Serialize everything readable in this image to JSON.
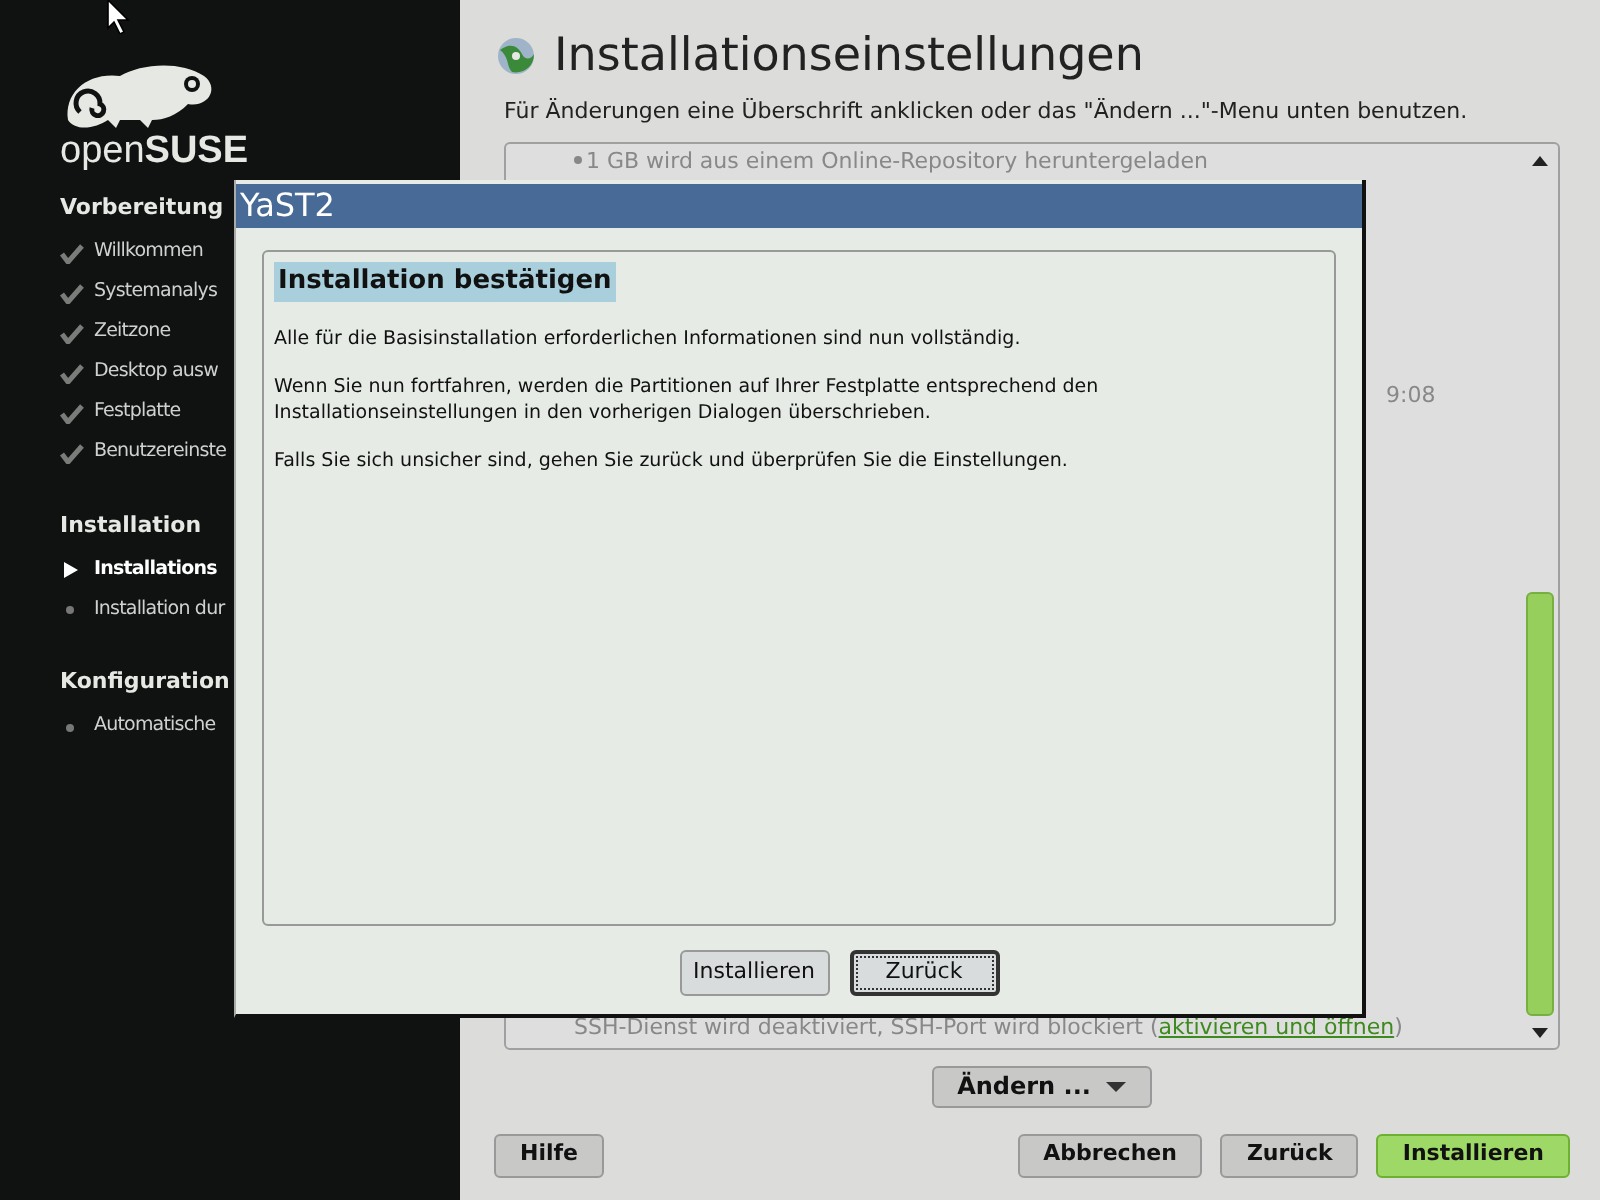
{
  "sidebar": {
    "logo_text": "open**SUSE**",
    "sections": [
      {
        "title": "Vorbereitung",
        "items": [
          {
            "label": "Willkommen",
            "done": true,
            "current": false
          },
          {
            "label": "Systemanalys",
            "done": true,
            "current": false
          },
          {
            "label": "Zeitzone",
            "done": true,
            "current": false
          },
          {
            "label": "Desktop ausw",
            "done": true,
            "current": false
          },
          {
            "label": "Festplatte",
            "done": true,
            "current": false
          },
          {
            "label": "Benutzereinste",
            "done": true,
            "current": false
          }
        ]
      },
      {
        "title": "Installation",
        "items": [
          {
            "label": "Installations",
            "done": false,
            "current": true
          },
          {
            "label": "Installation dur",
            "done": false,
            "current": false
          }
        ]
      },
      {
        "title": "Konfiguration",
        "items": [
          {
            "label": "Automatische",
            "done": false,
            "current": false
          }
        ]
      }
    ]
  },
  "main": {
    "title": "Installationseinstellungen",
    "hint": "Für Änderungen eine Überschrift anklicken oder das \"Ändern ...\"-Menu unten benutzen.",
    "summary": {
      "top_line": "1 GB wird aus einem Online-Repository heruntergeladen",
      "middle_fragment": "9:08",
      "bottom_line": "SSH-Dienst wird deaktiviert, SSH-Port wird blockiert (",
      "bottom_link": "aktivieren und öffnen",
      "bottom_end": ")"
    },
    "change_button": "Ändern ...",
    "buttons": [
      {
        "label": "Hilfe",
        "primary": false
      },
      {
        "label": "Abbrechen",
        "primary": false
      },
      {
        "label": "Zurück",
        "primary": false
      },
      {
        "label": "Installieren",
        "primary": true
      }
    ]
  },
  "dialog": {
    "title": "YaST2",
    "heading": "Installation bestätigen",
    "paragraphs": [
      "Alle für die Basisinstallation erforderlichen Informationen sind nun vollständig.",
      "Wenn Sie nun fortfahren, werden die Partitionen auf Ihrer Festplatte entsprechend den Installationseinstellungen in den vorherigen Dialogen überschrieben.",
      "Falls Sie sich unsicher sind, gehen Sie zurück und überprüfen Sie die Einstellungen."
    ],
    "buttons": [
      {
        "label": "Installieren",
        "focused": false
      },
      {
        "label": "Zurück",
        "focused": true
      }
    ]
  }
}
